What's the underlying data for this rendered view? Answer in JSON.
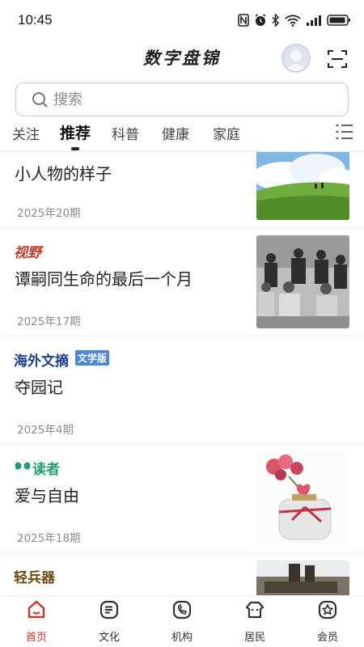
{
  "status_bar": {
    "time": "10:45",
    "icons": [
      "nfc-icon",
      "alarm-icon",
      "bluetooth-icon",
      "wifi-icon",
      "signal-icon",
      "battery-icon"
    ]
  },
  "header": {
    "title": "数字盘锦"
  },
  "search": {
    "placeholder": "搜索"
  },
  "tabs": [
    {
      "label": "关注",
      "active": false
    },
    {
      "label": "推荐",
      "active": true
    },
    {
      "label": "科普",
      "active": false
    },
    {
      "label": "健康",
      "active": false
    },
    {
      "label": "家庭",
      "active": false
    }
  ],
  "articles": [
    {
      "brand": "",
      "title": "小人物的样子",
      "issue": "2025年20期",
      "thumbnail": "landscape-hill-image"
    },
    {
      "brand": "视野",
      "brand_color": "#c0392b",
      "title": "谭嗣同生命的最后一个月",
      "issue": "2025年17期",
      "thumbnail": "historical-photo-image"
    },
    {
      "brand": "海外文摘",
      "brand_badge": "文学版",
      "brand_color": "#1d3f8f",
      "title": "夺园记",
      "issue": "2025年4期",
      "thumbnail": ""
    },
    {
      "brand": "读者",
      "brand_color": "#1e9e6a",
      "title": "爱与自由",
      "issue": "2025年18期",
      "thumbnail": "flower-jar-image"
    },
    {
      "brand": "轻兵器",
      "brand_color": "#6b4a10",
      "title": "",
      "issue": "",
      "thumbnail": "military-photo-image"
    }
  ],
  "bottom_nav": [
    {
      "label": "首页",
      "icon": "home-icon",
      "active": true
    },
    {
      "label": "文化",
      "icon": "culture-icon",
      "active": false
    },
    {
      "label": "机构",
      "icon": "institution-icon",
      "active": false
    },
    {
      "label": "居民",
      "icon": "residents-icon",
      "active": false
    },
    {
      "label": "会员",
      "icon": "member-icon",
      "active": false
    }
  ],
  "colors": {
    "accent": "#c0392b",
    "text": "#222222",
    "muted": "#8c8c8c"
  }
}
